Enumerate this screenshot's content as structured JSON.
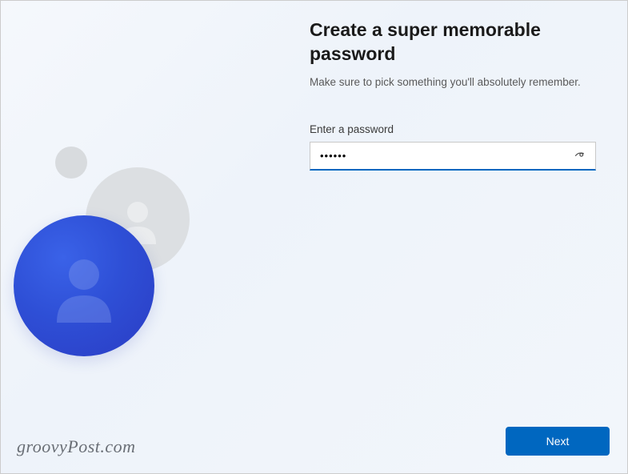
{
  "header": {
    "title": "Create a super memorable password",
    "subtitle": "Make sure to pick something you'll absolutely remember."
  },
  "password_field": {
    "label": "Enter a password",
    "value": "••••••",
    "reveal_title": "Show password"
  },
  "footer": {
    "next_label": "Next"
  },
  "watermark": "groovyPost.com"
}
